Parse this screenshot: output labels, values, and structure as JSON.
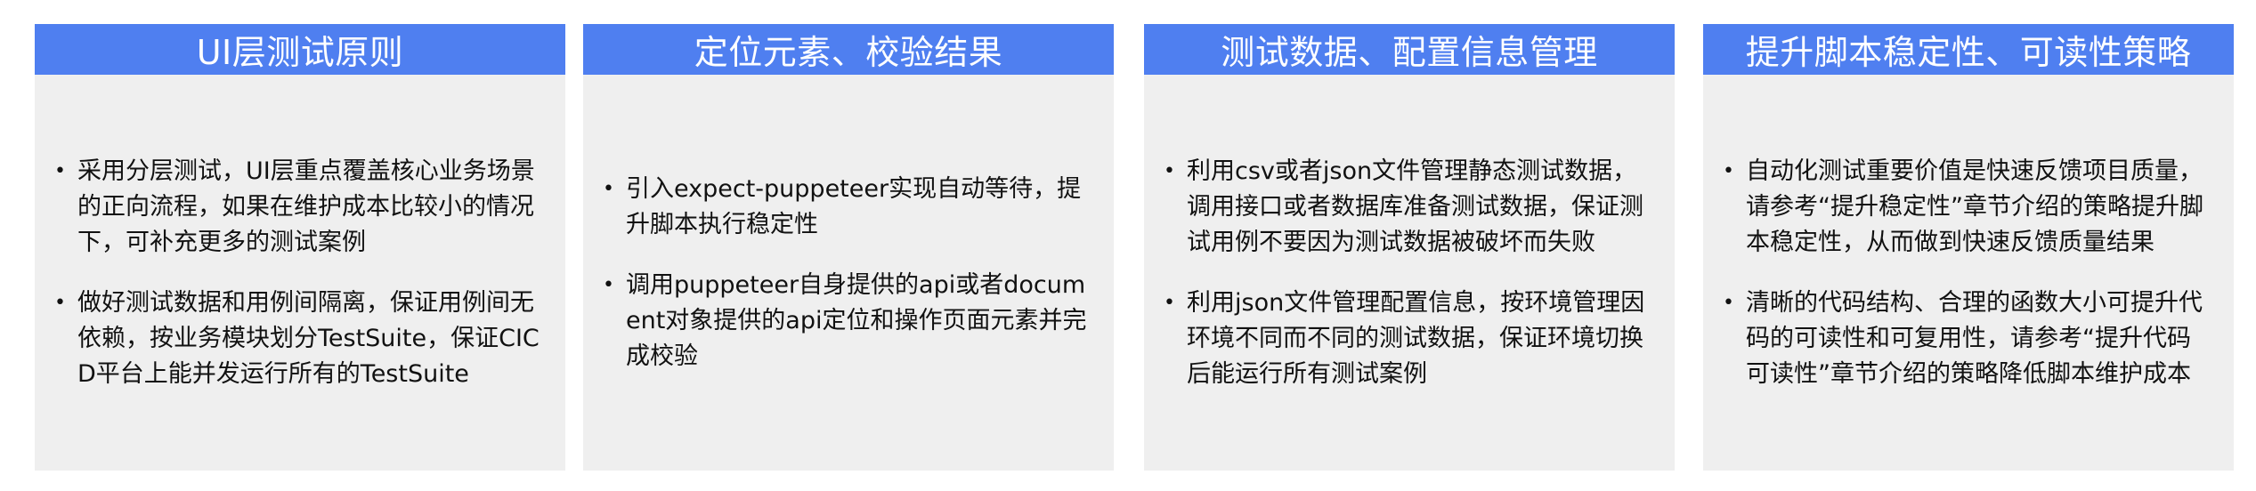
{
  "panels": [
    {
      "title": "UI层测试原则",
      "bullets": [
        "采用分层测试，UI层重点覆盖核心业务场景的正向流程，如果在维护成本比较小的情况下，可补充更多的测试案例",
        "做好测试数据和用例间隔离，保证用例间无依赖，按业务模块划分TestSuite，保证CICD平台上能并发运行所有的TestSuite"
      ]
    },
    {
      "title": "定位元素、校验结果",
      "bullets": [
        "引入expect-puppeteer实现自动等待，提升脚本执行稳定性",
        "调用puppeteer自身提供的api或者document对象提供的api定位和操作页面元素并完成校验"
      ]
    },
    {
      "title": "测试数据、配置信息管理",
      "bullets": [
        "利用csv或者json文件管理静态测试数据，调用接口或者数据库准备测试数据，保证测试用例不要因为测试数据被破坏而失败",
        "利用json文件管理配置信息，按环境管理因环境不同而不同的测试数据，保证环境切换后能运行所有测试案例"
      ]
    },
    {
      "title": "提升脚本稳定性、可读性策略",
      "bullets": [
        "自动化测试重要价值是快速反馈项目质量，请参考“提升稳定性”章节介绍的策略提升脚本稳定性，从而做到快速反馈质量结果",
        "清晰的代码结构、合理的函数大小可提升代码的可读性和可复用性，请参考“提升代码可读性”章节介绍的策略降低脚本维护成本"
      ]
    }
  ],
  "colors": {
    "header_bg": "#4f7ff0",
    "header_text": "#ffffff",
    "panel_bg": "#efefef",
    "body_text": "#111111"
  },
  "icons": {
    "bullet": "bullet-dot-icon"
  }
}
